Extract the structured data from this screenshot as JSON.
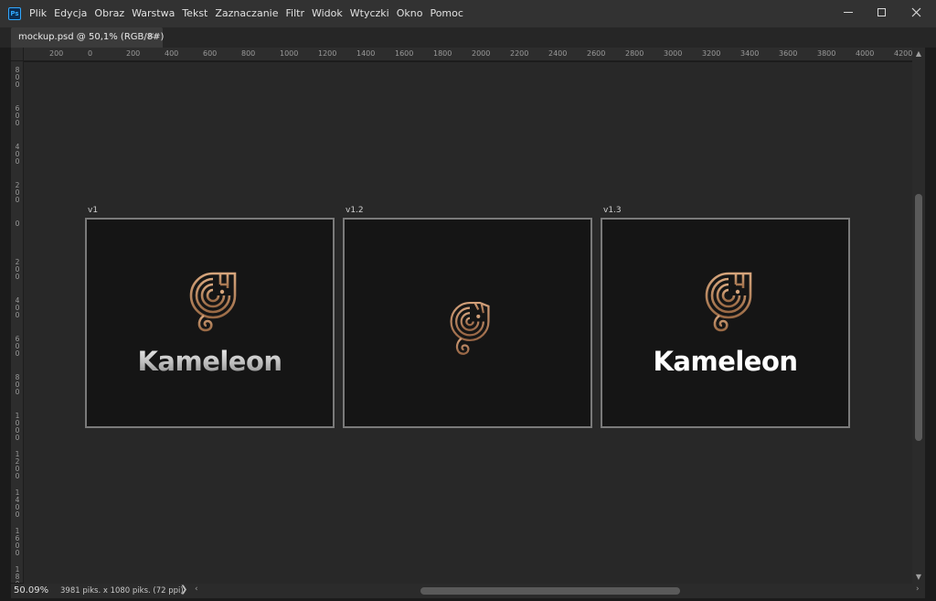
{
  "app": {
    "icon": "photoshop-icon",
    "icon_text": "Ps"
  },
  "menu": [
    "Plik",
    "Edycja",
    "Obraz",
    "Warstwa",
    "Tekst",
    "Zaznaczanie",
    "Filtr",
    "Widok",
    "Wtyczki",
    "Okno",
    "Pomoc"
  ],
  "window_controls": {
    "minimize": "minimize-icon",
    "maximize": "maximize-icon",
    "close": "close-icon"
  },
  "document_tab": {
    "title": "mockup.psd @ 50,1% (RGB/8#)",
    "close": "×"
  },
  "ruler_top": [
    "200",
    "0",
    "200",
    "400",
    "600",
    "800",
    "1000",
    "1200",
    "1400",
    "1600",
    "1800",
    "2000",
    "2200",
    "2400",
    "2600",
    "2800",
    "3000",
    "3200",
    "3400",
    "3600",
    "3800",
    "4000",
    "4200"
  ],
  "ruler_left": [
    "800",
    "600",
    "400",
    "200",
    "0",
    "200",
    "400",
    "600",
    "800",
    "1000",
    "1200",
    "1400",
    "1600",
    "1800"
  ],
  "artboards": [
    {
      "label": "v1",
      "wordmark": "Kameleon",
      "wordmark_style": "silver"
    },
    {
      "label": "v1.2",
      "wordmark": "",
      "wordmark_style": "none"
    },
    {
      "label": "v1.3",
      "wordmark": "Kameleon",
      "wordmark_style": "white"
    }
  ],
  "colors": {
    "logo_copper": "#c4936a",
    "logo_copper_dark": "#9a6a45",
    "artboard_bg": "#151515",
    "canvas_bg": "#282828"
  },
  "status": {
    "zoom": "50.09%",
    "doc_info": "3981 piks. x 1080 piks. (72 ppi)",
    "arrow": "❯"
  }
}
